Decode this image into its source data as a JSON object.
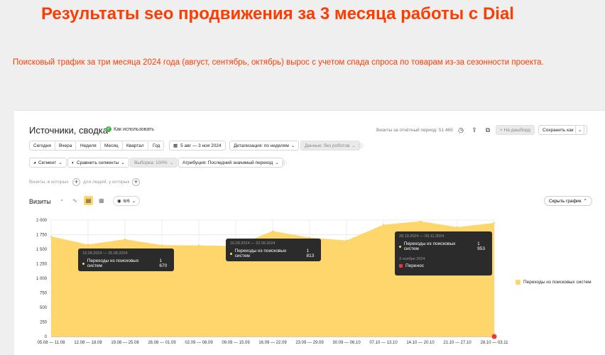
{
  "headline": "Результаты seo продвижения за 3 месяца работы с Dial",
  "subline": "Поисковый трафик за три месяца 2024 года (август, сентябрь, октябрь) вырос с учетом спада спроса по товарам из-за сезонности проекта.",
  "report": {
    "title": "Источники, сводка",
    "howto": "Как использовать",
    "visits_meta": "Визиты за отчётный период: 51 465",
    "dashboard_btn": "+ На дашборд",
    "save_btn": "Сохранить как",
    "periods": [
      "Сегодня",
      "Вчера",
      "Неделя",
      "Месяц",
      "Квартал",
      "Год"
    ],
    "date_range": "5 авг — 3 ноя 2024",
    "detail": "Детализация: по неделям",
    "robots": "Данные: без роботов",
    "segment": "Сегмент",
    "compare": "Сравнить сегменты",
    "sample": "Выборка: 100%",
    "attribution": "Атрибуция: Последний значимый переход",
    "visits_which": "Визиты, в которых",
    "for_people": "для людей, у которых",
    "metric": "Визиты",
    "series_count": "6/6",
    "hide_chart": "Скрыть график"
  },
  "tooltips": [
    {
      "range": "19.08.2024 — 25.08.2024",
      "label": "Переходы из поисковых систем",
      "value": "1 670"
    },
    {
      "range": "16.09.2024 — 22.09.2024",
      "label": "Переходы из поисковых систем",
      "value": "1 813"
    },
    {
      "range": "28.10.2024 — 03.11.2024",
      "label": "Переходы из поисковых систем",
      "value": "1 953",
      "note_date": "3 ноября 2024",
      "note_label": "Перенос"
    }
  ],
  "colors": {
    "accent": "#ff3b00",
    "area": "#ffd66b",
    "tooltip_bg": "#2b2b2b"
  },
  "chart_data": {
    "type": "area",
    "categories": [
      "05.08 — 11.08",
      "12.08 — 18.08",
      "19.08 — 25.08",
      "26.08 — 01.09",
      "02.09 — 08.09",
      "09.09 — 15.09",
      "16.09 — 22.09",
      "23.09 — 29.09",
      "30.09 — 06.10",
      "07.10 — 13.10",
      "14.10 — 20.10",
      "21.10 — 27.10",
      "28.10 — 03.11"
    ],
    "series": [
      {
        "name": "Переходы из поисковых систем",
        "values": [
          1720,
          1580,
          1670,
          1570,
          1565,
          1555,
          1813,
          1700,
          1650,
          1920,
          1980,
          1880,
          1953
        ]
      }
    ],
    "yticks": [
      "0",
      "250",
      "500",
      "750",
      "1 000",
      "1 250",
      "1 500",
      "1 750",
      "2 000"
    ],
    "ylim": [
      0,
      2000
    ],
    "grid": true,
    "legend": "right"
  }
}
